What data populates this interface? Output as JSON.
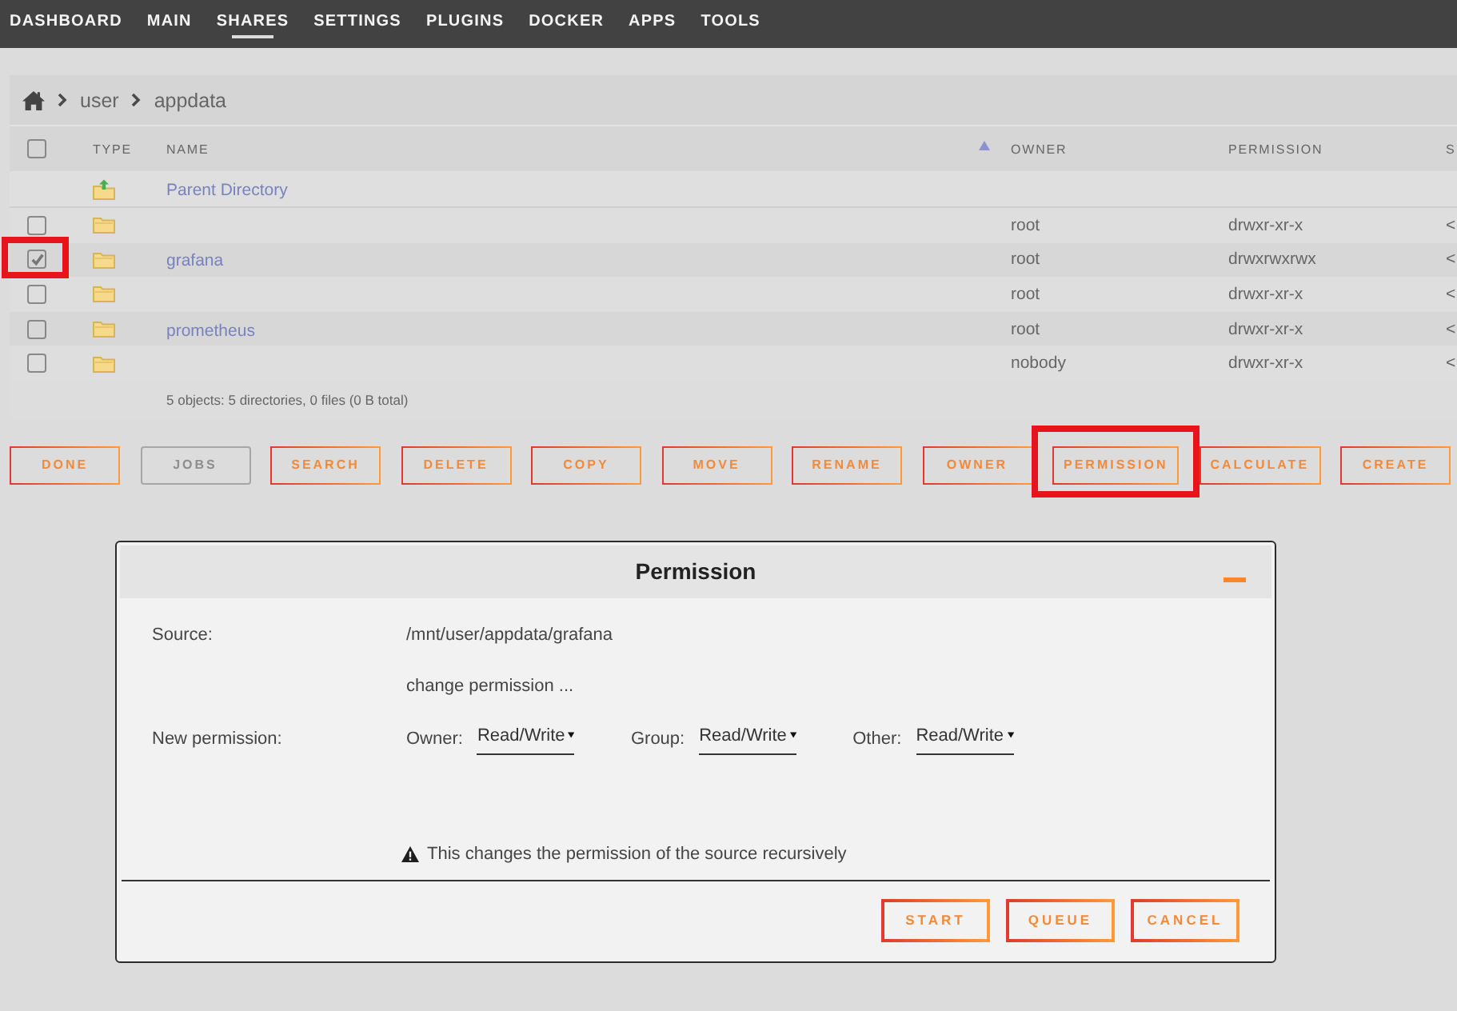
{
  "nav": [
    {
      "label": "DASHBOARD",
      "selected": false
    },
    {
      "label": "MAIN",
      "selected": false
    },
    {
      "label": "SHARES",
      "selected": true
    },
    {
      "label": "SETTINGS",
      "selected": false
    },
    {
      "label": "PLUGINS",
      "selected": false
    },
    {
      "label": "DOCKER",
      "selected": false
    },
    {
      "label": "APPS",
      "selected": false
    },
    {
      "label": "TOOLS",
      "selected": false
    }
  ],
  "breadcrumb": [
    "user",
    "appdata"
  ],
  "table": {
    "select_all_checked": false,
    "columns": [
      {
        "label": "TYPE",
        "sorted": false
      },
      {
        "label": "NAME",
        "sorted": true
      },
      {
        "label": "OWNER",
        "sorted": false
      },
      {
        "label": "PERMISSION",
        "sorted": false
      },
      {
        "label": "S",
        "sorted": false
      }
    ],
    "rows": [
      {
        "kind": "parent",
        "name": "Parent Directory"
      },
      {
        "kind": "folder",
        "checked": false,
        "highlighted": false,
        "owner": "root",
        "permission": "drwxr-xr-x",
        "column_5": "<"
      },
      {
        "kind": "folder",
        "checked": true,
        "highlighted": true,
        "name": "grafana",
        "owner": "root",
        "permission": "drwxrwxrwx",
        "column_5": "<"
      },
      {
        "kind": "folder",
        "checked": false,
        "highlighted": false,
        "owner": "root",
        "permission": "drwxr-xr-x",
        "column_5": "<"
      },
      {
        "kind": "folder",
        "checked": false,
        "highlighted": false,
        "name": "prometheus",
        "owner": "root",
        "permission": "drwxr-xr-x",
        "column_5": "<"
      },
      {
        "kind": "folder",
        "checked": false,
        "highlighted": false,
        "owner": "nobody",
        "permission": "drwxr-xr-x",
        "column_5": "<"
      }
    ],
    "summary": "5 objects: 5 directories, 0 files (0 B total)"
  },
  "actions": [
    {
      "label": "DONE",
      "disabled": false,
      "highlighted": false
    },
    {
      "label": "JOBS",
      "disabled": true,
      "highlighted": false
    },
    {
      "label": "SEARCH",
      "disabled": false,
      "highlighted": false
    },
    {
      "label": "DELETE",
      "disabled": false,
      "highlighted": false
    },
    {
      "label": "COPY",
      "disabled": false,
      "highlighted": false
    },
    {
      "label": "MOVE",
      "disabled": false,
      "highlighted": false
    },
    {
      "label": "RENAME",
      "disabled": false,
      "highlighted": false
    },
    {
      "label": "OWNER",
      "disabled": false,
      "highlighted": false
    },
    {
      "label": "PERMISSION",
      "disabled": false,
      "highlighted": true
    },
    {
      "label": "CALCULATE",
      "disabled": false,
      "highlighted": false
    },
    {
      "label": "CREATE",
      "disabled": false,
      "highlighted": false
    }
  ],
  "dialog": {
    "title": "Permission",
    "source_label": "Source:",
    "source": "/mnt/user/appdata/grafana",
    "hint": "change permission ...",
    "new_permission_label": "New permission:",
    "selects": [
      {
        "label": "Owner:",
        "value": "Read/Write"
      },
      {
        "label": "Group:",
        "value": "Read/Write"
      },
      {
        "label": "Other:",
        "value": "Read/Write"
      }
    ],
    "warning": "This changes the permission of the source recursively",
    "buttons": [
      {
        "label": "START"
      },
      {
        "label": "QUEUE"
      },
      {
        "label": "CANCEL"
      }
    ]
  }
}
